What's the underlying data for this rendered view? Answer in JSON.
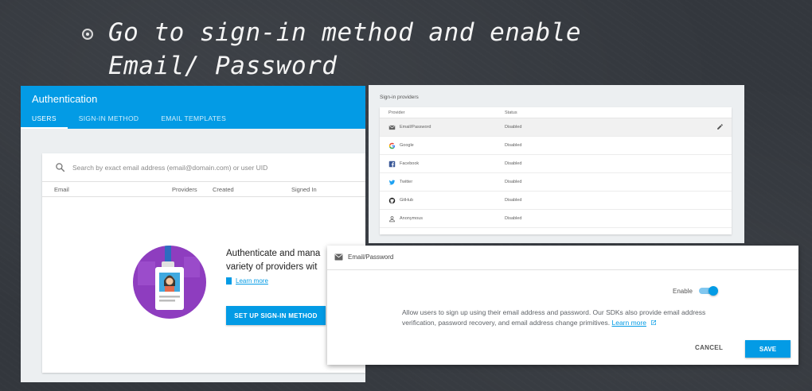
{
  "slide": {
    "bullet_text": "Go to sign-in method and enable Email/ Password"
  },
  "auth": {
    "title": "Authentication",
    "tabs": [
      "USERS",
      "SIGN-IN METHOD",
      "EMAIL TEMPLATES"
    ],
    "search_placeholder": "Search by exact email address (email@domain.com) or user UID",
    "columns": [
      "Email",
      "Providers",
      "Created",
      "Signed In"
    ],
    "empty_state": {
      "title_line1": "Authenticate and mana",
      "title_line2": "variety of providers wit",
      "learn_more": "Learn more",
      "setup_button": "SET UP SIGN-IN METHOD"
    }
  },
  "providers": {
    "title": "Sign-in providers",
    "header_provider": "Provider",
    "header_status": "Status",
    "rows": [
      {
        "name": "Email/Password",
        "status": "Disabled",
        "icon": "mail-icon"
      },
      {
        "name": "Google",
        "status": "Disabled",
        "icon": "google-icon"
      },
      {
        "name": "Facebook",
        "status": "Disabled",
        "icon": "facebook-icon"
      },
      {
        "name": "Twitter",
        "status": "Disabled",
        "icon": "twitter-icon"
      },
      {
        "name": "GitHub",
        "status": "Disabled",
        "icon": "github-icon"
      },
      {
        "name": "Anonymous",
        "status": "Disabled",
        "icon": "person-icon"
      }
    ]
  },
  "dialog": {
    "title": "Email/Password",
    "enable_label": "Enable",
    "enabled": true,
    "description": "Allow users to sign up using their email address and password. Our SDKs also provide email address verification, password recovery, and email address change primitives.",
    "learn_more": "Learn more",
    "cancel_label": "CANCEL",
    "save_label": "SAVE"
  },
  "colors": {
    "accent": "#039be5",
    "background": "#33373d"
  }
}
